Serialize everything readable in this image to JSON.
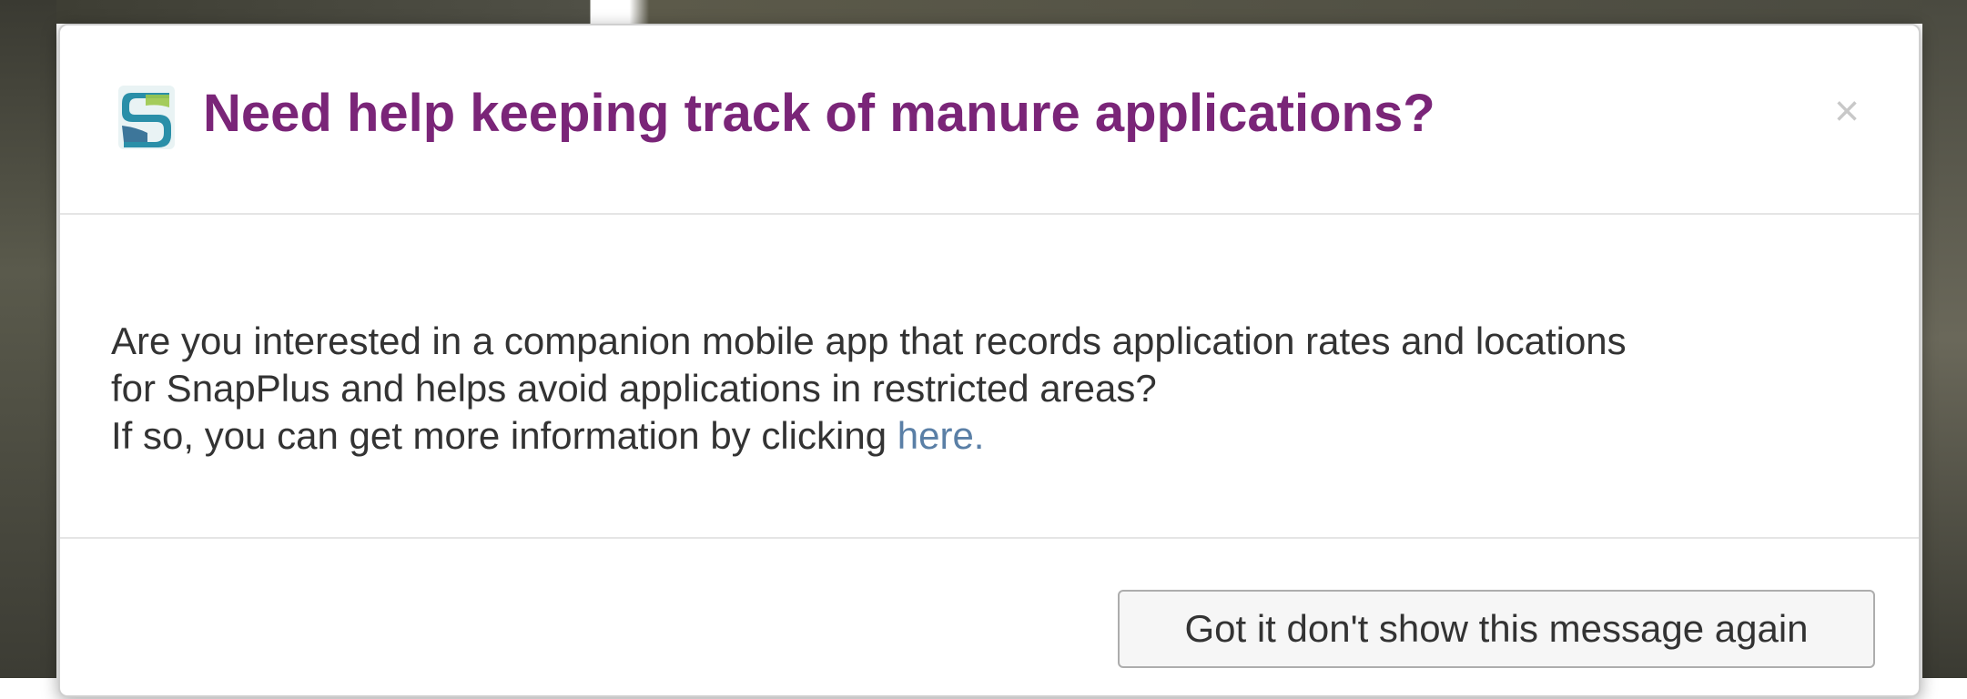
{
  "modal": {
    "title": "Need help keeping track of manure applications?",
    "close_label": "×",
    "logo_icon": "snapplus-logo-icon",
    "body": {
      "line1": "Are you interested in a companion mobile app that records application rates and locations",
      "line2": "for SnapPlus and helps avoid applications in restricted areas?",
      "line3_prefix": "If so, you can get more information by clicking ",
      "link_text": "here."
    },
    "dismiss_button_label": "Got it don't show this message again"
  },
  "colors": {
    "title": "#7a2578",
    "link": "#5a7fa6",
    "body_text": "#333333",
    "close": "#c8c8c8",
    "logo_primary": "#2a8fa8",
    "logo_secondary": "#9cc84a"
  }
}
